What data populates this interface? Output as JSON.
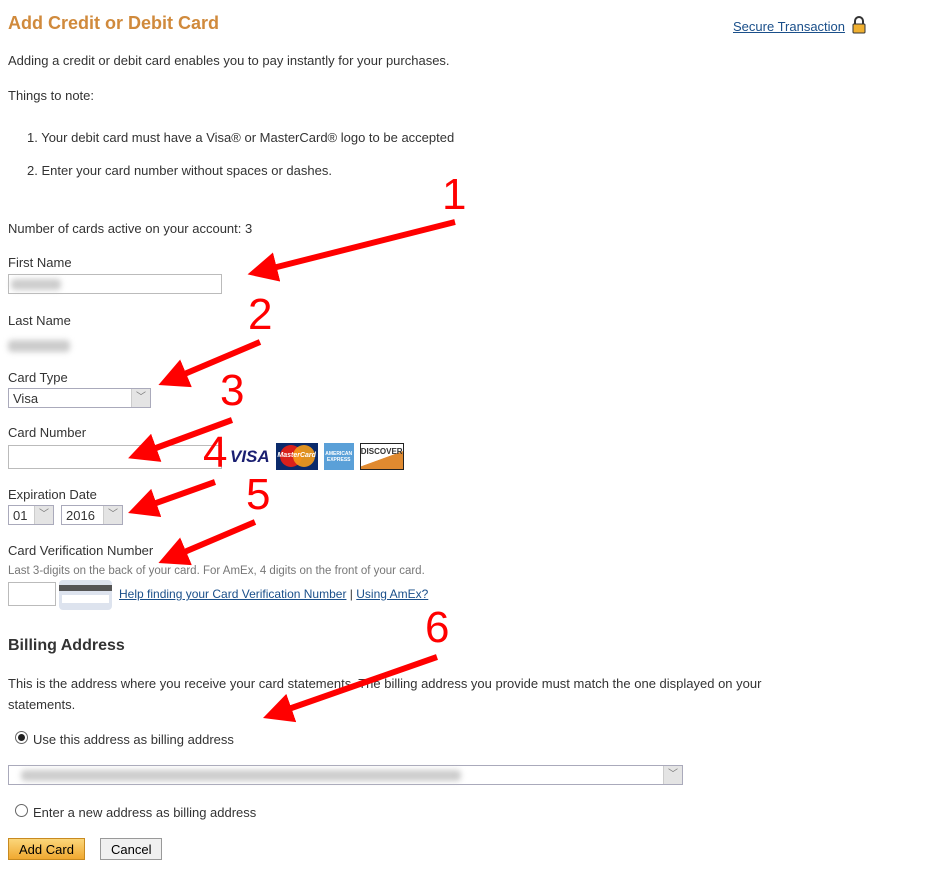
{
  "header": {
    "title": "Add Credit or Debit Card",
    "secure_link": "Secure Transaction",
    "lock_icon": "lock-icon"
  },
  "intro": "Adding a credit or debit card enables you to pay instantly for your purchases.",
  "notes_title": "Things to note:",
  "notes": [
    "1.  Your debit card must have a Visa® or MasterCard® logo to be accepted",
    "2.  Enter your card number without spaces or dashes."
  ],
  "cards_active": "Number of cards active on your account: 3",
  "form": {
    "first_name_label": "First Name",
    "last_name_label": "Last Name",
    "card_type_label": "Card Type",
    "card_type_value": "Visa",
    "card_number_label": "Card Number",
    "card_number_value": "",
    "card_logos": [
      "VISA",
      "MasterCard",
      "American Express",
      "DISCOVER"
    ],
    "exp_label": "Expiration Date",
    "exp_month": "01",
    "exp_year": "2016",
    "cvv_label": "Card Verification Number",
    "cvv_hint": "Last 3-digits on the back of your card. For AmEx, 4 digits on the front of your card.",
    "cvv_help_link": "Help finding your Card Verification Number",
    "separator": "|",
    "amex_link": "Using AmEx?"
  },
  "billing": {
    "title": "Billing Address",
    "desc": "This is the address where you receive your card statements. The billing address you provide must match the one displayed on your statements.",
    "option_existing": "Use this address as billing address",
    "option_new": "Enter a new address as billing address",
    "selected": "existing"
  },
  "buttons": {
    "add": "Add Card",
    "cancel": "Cancel"
  },
  "annotations": {
    "color": "#ff0000",
    "labels": [
      "1",
      "2",
      "3",
      "4",
      "5",
      "6"
    ]
  }
}
